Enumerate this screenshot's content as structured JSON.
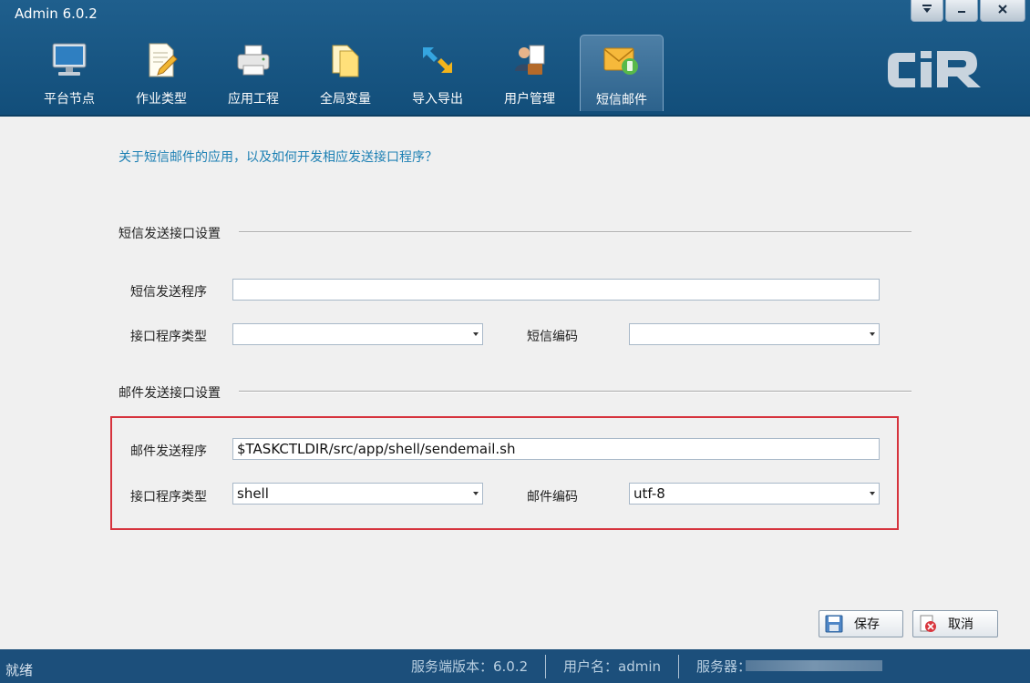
{
  "window": {
    "title": "Admin 6.0.2"
  },
  "window_controls": {
    "dropdown_icon": "chevron-down-icon",
    "minimize_icon": "minimize-icon",
    "close_icon": "close-icon"
  },
  "tabs": [
    {
      "label": "平台节点",
      "icon": "monitor-icon"
    },
    {
      "label": "作业类型",
      "icon": "document-edit-icon"
    },
    {
      "label": "应用工程",
      "icon": "printer-icon"
    },
    {
      "label": "全局变量",
      "icon": "files-icon"
    },
    {
      "label": "导入导出",
      "icon": "import-export-arrows-icon"
    },
    {
      "label": "用户管理",
      "icon": "user-admin-icon"
    },
    {
      "label": "短信邮件",
      "icon": "mail-phone-icon",
      "active": true
    }
  ],
  "logo": {
    "text": "CiR"
  },
  "help_link": "关于短信邮件的应用，以及如何开发相应发送接口程序？",
  "sms_section": {
    "title": "短信发送接口设置",
    "program_label": "短信发送程序",
    "program_value": "",
    "type_label": "接口程序类型",
    "type_value": "",
    "encoding_label": "短信编码",
    "encoding_value": ""
  },
  "mail_section": {
    "title": "邮件发送接口设置",
    "program_label": "邮件发送程序",
    "program_value": "$TASKCTLDIR/src/app/shell/sendemail.sh",
    "type_label": "接口程序类型",
    "type_value": "shell",
    "encoding_label": "邮件编码",
    "encoding_value": "utf-8"
  },
  "buttons": {
    "save": "保存",
    "cancel": "取消"
  },
  "status_bar": {
    "ready": "就绪",
    "server_version": "服务端版本：6.0.2",
    "username": "用户名：admin",
    "server": "服务器："
  },
  "colors": {
    "header": "#1f5f8d",
    "link": "#1b7fb3",
    "highlight": "#d6333d",
    "status": "#1c4f7b"
  }
}
